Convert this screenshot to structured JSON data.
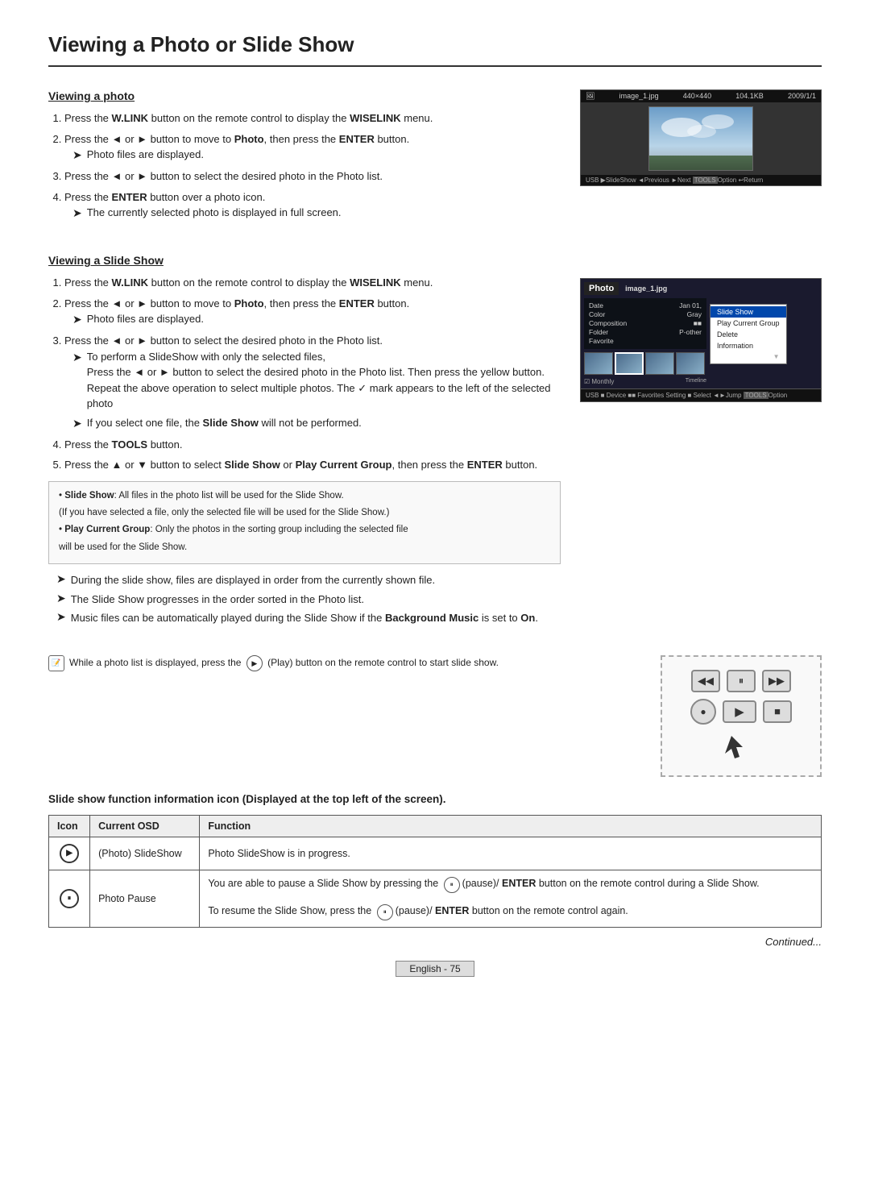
{
  "page": {
    "title": "Viewing a Photo or Slide Show"
  },
  "section1": {
    "title": "Viewing a photo",
    "steps": [
      {
        "num": 1,
        "text": "Press the ",
        "bold1": "W.LINK",
        "mid1": " button on the remote control to display the ",
        "bold2": "WISELINK",
        "end": " menu."
      },
      {
        "num": 2,
        "text": "Press the ◄ or ► button to move to ",
        "bold": "Photo",
        "end": ", then press the ",
        "bold2": "ENTER",
        "end2": " button."
      },
      {
        "num": 3,
        "text": "Press the ◄ or ► button to select the desired photo in the Photo list."
      },
      {
        "num": 4,
        "text": "Press the ",
        "bold": "ENTER",
        "end": " button over a photo icon."
      }
    ],
    "arrows": [
      "Photo files are displayed.",
      "The currently selected photo is displayed in full screen."
    ],
    "screen": {
      "topbar": "image_1.jpg    440×440    104.1KB    2009/1/1",
      "bottombar": "USB  ▶Slide Show  ◄Previous  ►Next  TOOLS Option  ↩Return"
    }
  },
  "section2": {
    "title": "Viewing a Slide Show",
    "steps": [
      {
        "num": 1,
        "text_pre": "Press the ",
        "bold1": "W.LINK",
        "text_mid": " button on the remote control to display the ",
        "bold2": "WISELINK",
        "text_end": " menu."
      },
      {
        "num": 2,
        "text_pre": "Press the ◄ or ► button to move to ",
        "bold": "Photo",
        "text_end": ", then press the ",
        "bold2": "ENTER",
        "text_end2": " button."
      },
      {
        "num": 3,
        "text": "Press the ◄ or ► button to select the desired photo in the Photo list."
      },
      {
        "num": 4,
        "text_pre": "Press the ",
        "bold": "TOOLS",
        "text_end": " button."
      },
      {
        "num": 5,
        "text_pre": "Press the ▲ or ▼ button to select ",
        "bold1": "Slide Show",
        "text_mid": " or ",
        "bold2": "Play Current Group",
        "text_end": ", then press the ",
        "bold3": "ENTER",
        "text_end2": " button."
      }
    ],
    "step2_arrows": [
      "Photo files are displayed."
    ],
    "step3_arrows": [
      "To perform a SlideShow with only the selected files,",
      "Press the ◄ or ► button to select the desired photo in the Photo list. Then press the yellow button. Repeat the above operation to select multiple photos. The ✓ mark appears to the left of the selected photo",
      "If you select one file, the Slide Show will not be performed."
    ],
    "notebox": {
      "line1": "• Slide Show: All files in the photo list will be used for the Slide Show.",
      "line2": "(If you have selected a file, only the selected file will be used for the Slide Show.)",
      "line3": "• Play Current Group: Only the photos in the sorting group including the selected file",
      "line4": "will be used for the Slide Show."
    },
    "bottom_arrows": [
      "During the slide show, files are displayed in order from the currently shown file.",
      "The Slide Show progresses in the order sorted in the Photo list.",
      "Music files can be automatically played during the Slide Show if the Background Music is set to On."
    ],
    "bottom_bold": "Background Music",
    "bottom_bold_end": " is set to ",
    "bottom_on": "On",
    "screen": {
      "photo_label": "Photo",
      "filename": "image_1.jpg",
      "info_rows": [
        {
          "label": "Date",
          "value": "Jan 01,"
        },
        {
          "label": "Color",
          "value": "Gray"
        },
        {
          "label": "Composition",
          "value": ""
        },
        {
          "label": "Folder",
          "value": "P-other"
        },
        {
          "label": "Favorite",
          "value": ""
        }
      ],
      "menu_items": [
        "Slide Show",
        "Play Current Group",
        "Delete",
        "Information"
      ],
      "bottombar": "USB  ■ Device  ■■ Favorites Setting  ■ Select  ◄► Jump  TOOLS Option"
    }
  },
  "play_note": {
    "text": "While a photo list is displayed, press the",
    "play_label": "Play",
    "text2": " button on the remote control to start slide show."
  },
  "remote": {
    "row1": [
      "«",
      "⏸",
      "»"
    ],
    "row2": [
      "●",
      "▶",
      "■"
    ]
  },
  "slide_info_title": "Slide show function information icon (Displayed at the top left of the screen).",
  "table": {
    "headers": [
      "Icon",
      "Current OSD",
      "Function"
    ],
    "rows": [
      {
        "icon": "▶",
        "osd": "(Photo) SlideShow",
        "function": "Photo SlideShow is in progress."
      },
      {
        "icon": "⏸",
        "osd": "Photo Pause",
        "function": "You are able to pause a Slide Show by pressing the (pause)/ ENTER button on the remote control during a Slide Show.\nTo resume the Slide Show, press the (pause)/ ENTER button on the remote control again."
      }
    ]
  },
  "continued": "Continued...",
  "page_number": "English - 75"
}
